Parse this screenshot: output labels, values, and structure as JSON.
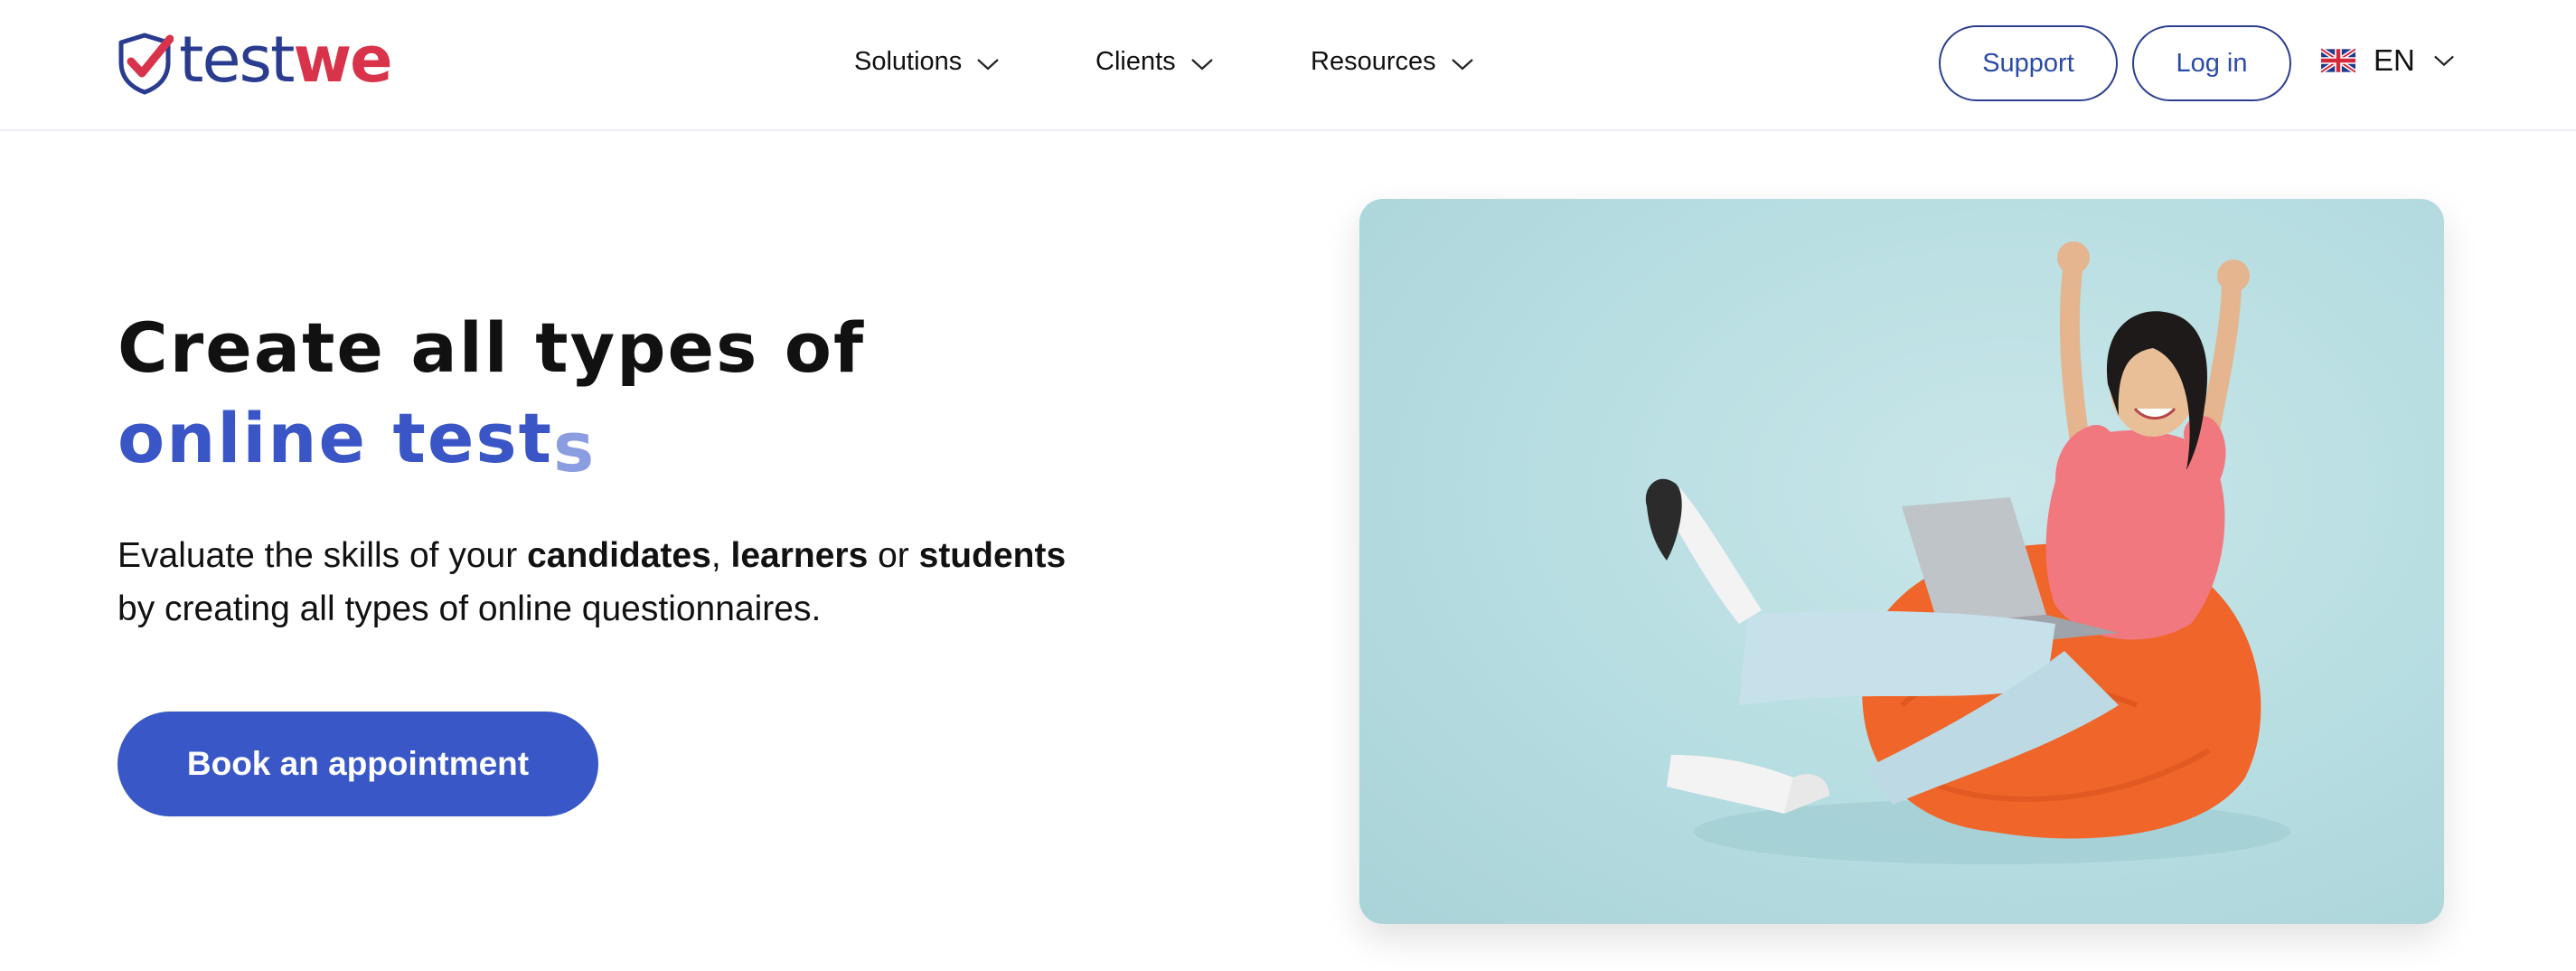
{
  "brand": {
    "name_part1": "test",
    "name_part2": "we",
    "colors": {
      "navy": "#2a3c8f",
      "red": "#d8334a",
      "primary": "#3a57c7"
    }
  },
  "nav": {
    "items": [
      {
        "label": "Solutions",
        "icon": "chevron-down-icon"
      },
      {
        "label": "Clients",
        "icon": "chevron-down-icon"
      },
      {
        "label": "Resources",
        "icon": "chevron-down-icon"
      }
    ],
    "support_label": "Support",
    "login_label": "Log in",
    "language": {
      "code": "EN",
      "flag_icon": "uk-flag-icon",
      "icon": "chevron-down-icon"
    }
  },
  "hero": {
    "title_line1": "Create all types of",
    "title_line2_main": "online test",
    "title_line2_fade": "s",
    "desc_part1": "Evaluate the skills of your ",
    "desc_bold1": "candidates",
    "desc_part2": ", ",
    "desc_bold2": "learners",
    "desc_part3": " or ",
    "desc_bold3": "students",
    "desc_part4": " by creating all types of online questionnaires.",
    "cta_label": "Book an appointment"
  }
}
